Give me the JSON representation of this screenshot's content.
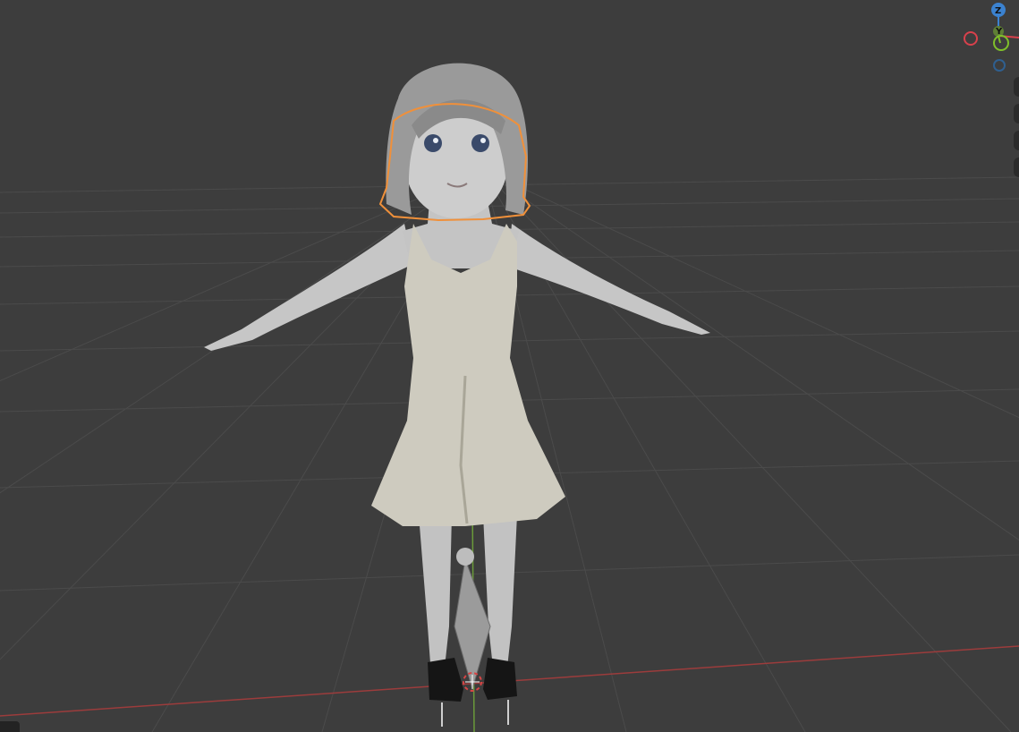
{
  "viewport": {
    "background": "#3d3d3d",
    "grid_color": "#4a4a4a",
    "x_axis_color": "#b04545",
    "y_axis_color": "#6a9a3a",
    "selection_outline_color": "#f0903a"
  },
  "gizmo": {
    "z_label": "Z",
    "y_label": "Y",
    "x_color": "#d8414c",
    "y_color": "#7fbf2a",
    "z_color": "#3b82d0",
    "neg_y_color": "#2f5f8f"
  },
  "side_buttons": [
    {
      "icon": "view-zoom-icon"
    },
    {
      "icon": "view-pan-icon"
    },
    {
      "icon": "camera-view-icon"
    },
    {
      "icon": "perspective-toggle-icon"
    }
  ],
  "object": {
    "icon": "character-mesh-icon",
    "skin_color": "#c8c8c8",
    "dress_color": "#cfcdc2",
    "shoe_color": "#141414",
    "eye_color": "#3a4a6a"
  }
}
